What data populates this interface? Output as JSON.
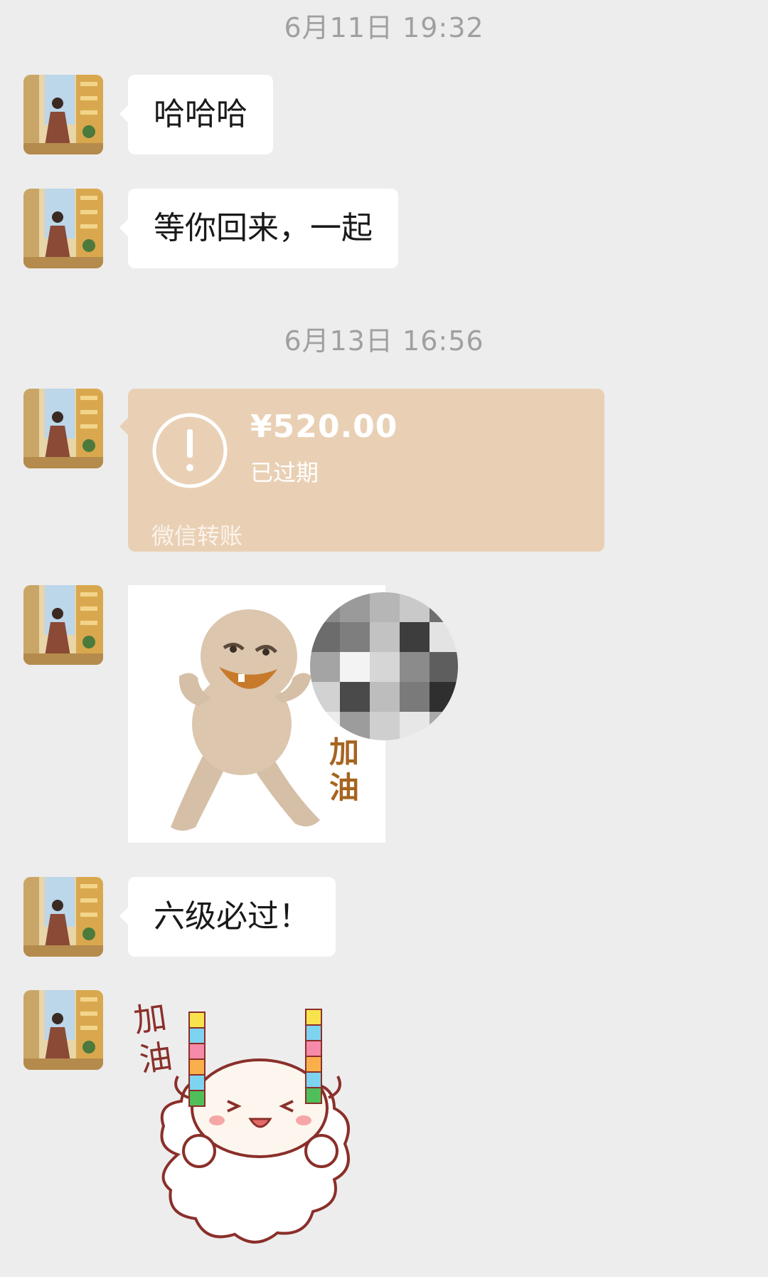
{
  "timestamps": [
    "6月11日 19:32",
    "6月13日 16:56"
  ],
  "messages": {
    "m1": "哈哈哈",
    "m2": "等你回来，一起",
    "m4": "六级必过！"
  },
  "transfer": {
    "amount": "¥520.00",
    "status": "已过期",
    "label": "微信转账",
    "icon": "exclamation-circle-icon"
  },
  "stickers": {
    "s1_text": "加油",
    "s2_text": "加油"
  },
  "colors": {
    "background": "#ededed",
    "bubble": "#ffffff",
    "transfer_expired": "#e9d0b5"
  }
}
